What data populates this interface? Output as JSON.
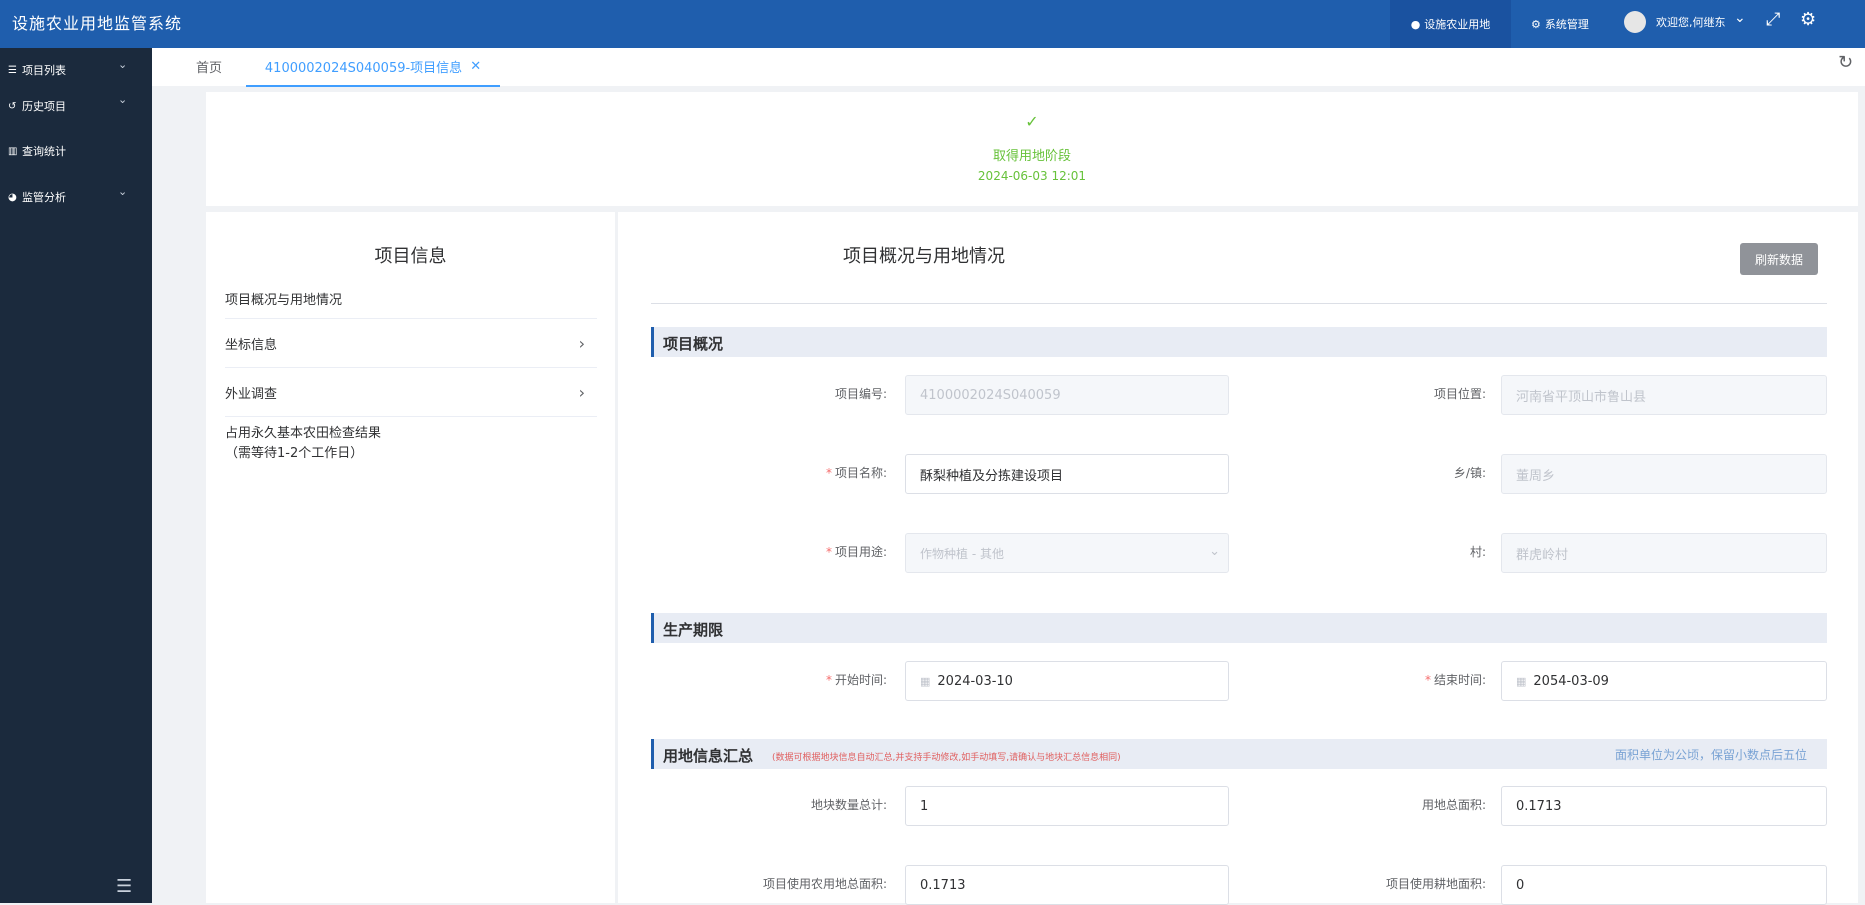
{
  "app": {
    "title": "设施农业用地监管系统"
  },
  "header": {
    "nav": [
      {
        "label": "设施农业用地",
        "icon": "globe-icon"
      },
      {
        "label": "系统管理",
        "icon": "cogs-icon"
      }
    ],
    "user": {
      "greeting": "欢迎您,何继东"
    },
    "tools": [
      "fullscreen-icon",
      "settings-icon"
    ]
  },
  "sidebar": {
    "items": [
      {
        "label": "项目列表",
        "icon": "list-icon"
      },
      {
        "label": "历史项目",
        "icon": "history-icon"
      },
      {
        "label": "查询统计",
        "icon": "bar-chart-icon"
      },
      {
        "label": "监管分析",
        "icon": "pie-chart-icon"
      }
    ]
  },
  "tabs": {
    "home": "首页",
    "active": "4100002024S040059-项目信息"
  },
  "stage": {
    "name": "取得用地阶段",
    "time": "2024-06-03 12:01"
  },
  "left_panel": {
    "title": "项目信息",
    "items": [
      {
        "label": "项目概况与用地情况"
      },
      {
        "label": "坐标信息"
      },
      {
        "label": "外业调查"
      },
      {
        "label": "占用永久基本农田检查结果",
        "sub": "（需等待1-2个工作日）"
      }
    ]
  },
  "main": {
    "title": "项目概况与用地情况",
    "refresh_label": "刷新数据",
    "section_overview": "项目概况",
    "fields_overview": [
      {
        "label": "项目编号:",
        "value": "4100002024S040059",
        "required": false,
        "disabled": true
      },
      {
        "label": "项目位置:",
        "value": "河南省平顶山市鲁山县",
        "required": false,
        "disabled": true
      },
      {
        "label": "项目名称:",
        "value": "酥梨种植及分拣建设项目",
        "required": true,
        "disabled": false
      },
      {
        "label": "乡/镇:",
        "value": "董周乡",
        "required": false,
        "disabled": true
      },
      {
        "label": "项目用途:",
        "value": "作物种植 - 其他",
        "required": true,
        "disabled": true
      },
      {
        "label": "村:",
        "value": "群虎岭村",
        "required": false,
        "disabled": true
      }
    ],
    "section_period": "生产期限",
    "fields_period": [
      {
        "label": "开始时间:",
        "value": "2024-03-10",
        "required": true
      },
      {
        "label": "结束时间:",
        "value": "2054-03-09",
        "required": true
      }
    ],
    "section_land": "用地信息汇总",
    "land_note": "(数据可根据地块信息自动汇总,并支持手动修改,如手动填写,请确认与地块汇总信息相同)",
    "land_unit_note": "面积单位为公顷，保留小数点后五位",
    "fields_land": [
      {
        "label": "地块数量总计:",
        "value": "1"
      },
      {
        "label": "用地总面积:",
        "value": "0.1713"
      },
      {
        "label": "项目使用农用地总面积:",
        "value": "0.1713"
      },
      {
        "label": "项目使用耕地面积:",
        "value": "0"
      }
    ]
  }
}
